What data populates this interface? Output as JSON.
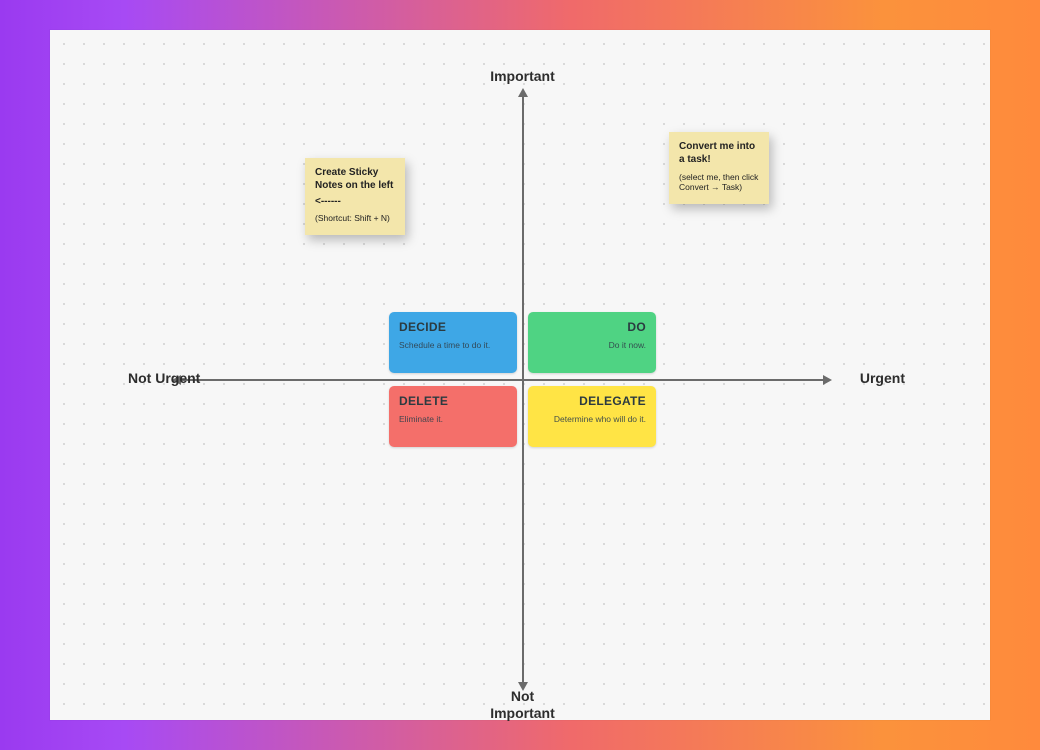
{
  "axes": {
    "top": "Important",
    "bottom": "Not\nImportant",
    "left": "Not Urgent",
    "right": "Urgent"
  },
  "quadrants": {
    "decide": {
      "title": "DECIDE",
      "sub": "Schedule a time to do it."
    },
    "do": {
      "title": "DO",
      "sub": "Do it now."
    },
    "delete": {
      "title": "DELETE",
      "sub": "Eliminate it."
    },
    "delegate": {
      "title": "DELEGATE",
      "sub": "Determine who will do it."
    }
  },
  "stickies": {
    "left": {
      "line1": "Create Sticky Notes on the left",
      "line2": "<------",
      "line3": "(Shortcut: Shift + N)"
    },
    "right": {
      "line1": "Convert me into a task!",
      "line3": "(select me, then click Convert → Task)"
    }
  },
  "colors": {
    "decide": "#3ea7e6",
    "do": "#4fd383",
    "delete": "#f46f6a",
    "delegate": "#ffe445",
    "sticky": "#f3e6ab"
  }
}
